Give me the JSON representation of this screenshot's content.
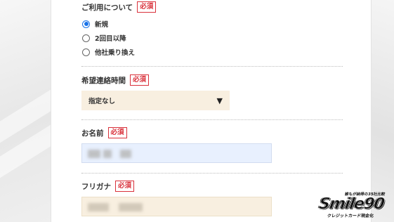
{
  "form": {
    "usage": {
      "label": "ご利用について",
      "required_badge": "必須",
      "options": [
        {
          "label": "新規",
          "checked": true
        },
        {
          "label": "2回目以降",
          "checked": false
        },
        {
          "label": "他社乗り換え",
          "checked": false
        }
      ]
    },
    "contact_time": {
      "label": "希望連絡時間",
      "required_badge": "必須",
      "selected_value": "指定なし",
      "arrow": "▼"
    },
    "name": {
      "label": "お名前",
      "required_badge": "必須",
      "value_state": "blurred"
    },
    "furigana": {
      "label": "フリガナ",
      "required_badge": "必須",
      "value_state": "blurred"
    }
  },
  "logo": {
    "top_text": "誰もが納得の35社比較",
    "main_text": "Smile90",
    "bottom_text": "クレジットカード現金化"
  },
  "colors": {
    "required_red": "#d9313b",
    "radio_blue": "#1a73e8",
    "select_bg": "#f8efe0",
    "name_input_bg": "#e8f0fe"
  }
}
